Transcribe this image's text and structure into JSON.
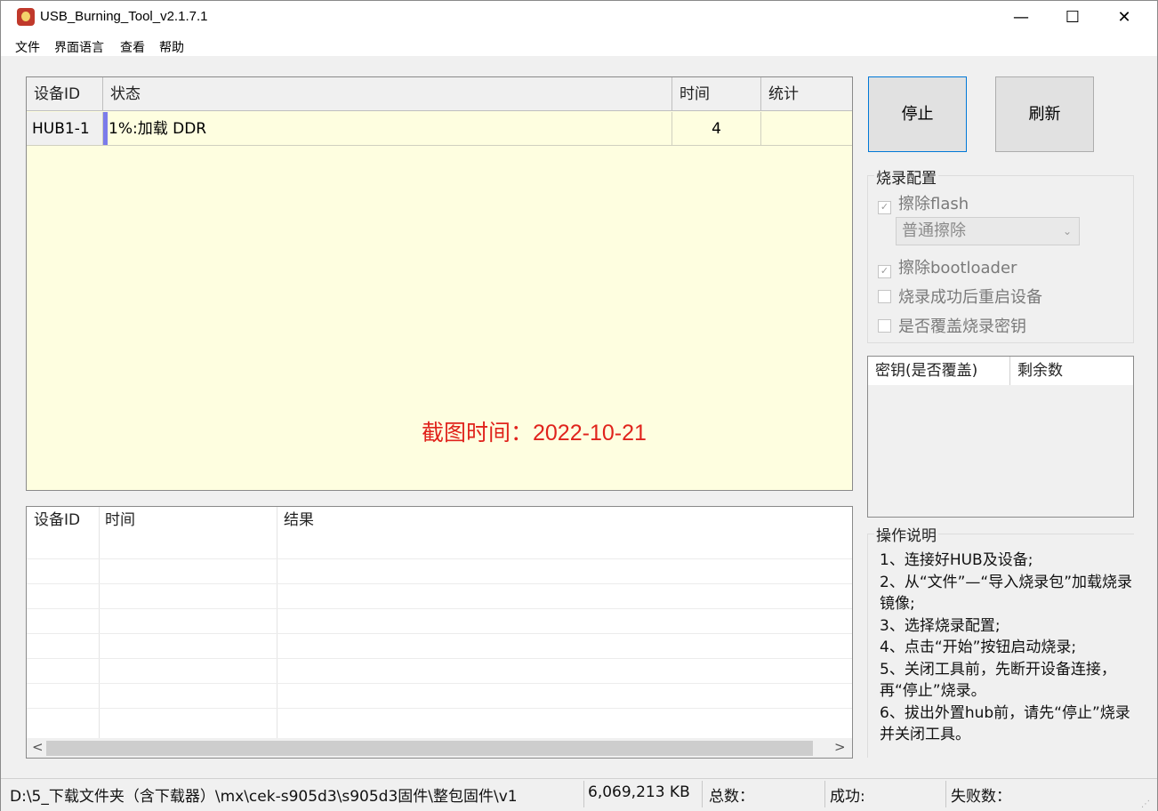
{
  "window": {
    "title": "USB_Burning_Tool_v2.1.7.1",
    "minimize": "—",
    "maximize": "☐",
    "close": "✕"
  },
  "menu": [
    "文件",
    "界面语言",
    "查看",
    "帮助"
  ],
  "device_table": {
    "headers": [
      "设备ID",
      "状态",
      "时间",
      "统计"
    ],
    "rows": [
      {
        "device_id": "HUB1-1",
        "status": "1%:加载 DDR",
        "time": "4",
        "stats": ""
      }
    ],
    "watermark": "截图时间：2022-10-21"
  },
  "log_table": {
    "headers": [
      "设备ID",
      "时间",
      "结果"
    ],
    "scroll_left": "<",
    "scroll_right": ">"
  },
  "buttons": {
    "stop": "停止",
    "refresh": "刷新"
  },
  "burn_config": {
    "title": "烧录配置",
    "erase_flash": {
      "label": "擦除flash",
      "checked": true
    },
    "erase_mode": "普通擦除",
    "erase_bootloader": {
      "label": "擦除bootloader",
      "checked": true
    },
    "reboot_after": {
      "label": "烧录成功后重启设备",
      "checked": false
    },
    "overwrite_key": {
      "label": "是否覆盖烧录密钥",
      "checked": false
    }
  },
  "key_table": {
    "headers": [
      "密钥(是否覆盖)",
      "剩余数"
    ]
  },
  "instructions": {
    "title": "操作说明",
    "lines": [
      "1、连接好HUB及设备;",
      "2、从“文件”—“导入烧录包”加载烧录镜像;",
      "3、选择烧录配置;",
      "4、点击“开始”按钮启动烧录;",
      "5、关闭工具前，先断开设备连接，再“停止”烧录。",
      "6、拔出外置hub前，请先“停止”烧录并关闭工具。"
    ]
  },
  "status_bar": {
    "path": "D:\\5_下载文件夹（含下载器）\\mx\\cek-s905d3\\s905d3固件\\整包固件\\v1",
    "size": "6,069,213 KB",
    "total": "总数：",
    "success": "成功:",
    "failed": "失败数："
  },
  "colors": {
    "device_table_bg": "#fefee0",
    "watermark": "#e0231c",
    "focus_border": "#0078d7"
  }
}
